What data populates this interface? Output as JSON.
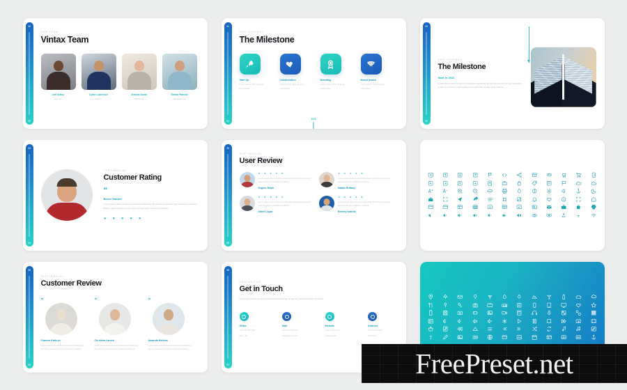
{
  "canvas": {
    "background": "#eceded",
    "accent_teal": "#1fb9c2",
    "accent_blue": "#1860bd"
  },
  "watermark": {
    "text": "FreePreset.net"
  },
  "slides": [
    {
      "id": "team",
      "page_top": "30",
      "page_bottom": "30",
      "eyebrow": "OUR TEAM",
      "title": "Vintax Team",
      "members": [
        {
          "name": "Carl Arthur",
          "role": "Founder"
        },
        {
          "name": "Dylan Lawrence",
          "role": "Expert"
        },
        {
          "name": "Jessica Sarah",
          "role": "Marketing"
        },
        {
          "name": "Emma Pamela",
          "role": "Management"
        }
      ]
    },
    {
      "id": "milestone-icons",
      "page_top": "31",
      "page_bottom": "31",
      "eyebrow": "OUR JOURNEY",
      "title": "The Milestone",
      "items": [
        {
          "icon": "rocket-icon",
          "label": "Start Up",
          "text": "Lorem ipsum dolor sit amet consectetur",
          "color": "teal"
        },
        {
          "icon": "handshake-icon",
          "label": "Collaboration",
          "text": "Lorem ipsum dolor sit amet consectetur",
          "color": "blue"
        },
        {
          "icon": "medal-icon",
          "label": "Branding",
          "text": "Lorem ipsum dolor sit amet consectetur",
          "color": "teal"
        },
        {
          "icon": "trophy-icon",
          "label": "Brand Award",
          "text": "Lorem ipsum dolor sit amet consectetur",
          "color": "blue"
        }
      ],
      "timeline_year": "2020"
    },
    {
      "id": "milestone-detail",
      "page_top": "32",
      "page_bottom": "32",
      "eyebrow": "OUR JOURNEY",
      "title": "The Milestone",
      "subtitle": "Start in 2022",
      "body": "Lorem ipsum dolor sit amet consectetur adipiscing elit sed do eiusmod tempor incididunt ut labore et dolore magna aliqua enim ad minim veniam quis nostrud.",
      "year_marker": "2022",
      "image_alt": "modern-building-photo"
    },
    {
      "id": "customer-rating",
      "page_top": "33",
      "page_bottom": "34",
      "eyebrow": "TESTIMONIAL",
      "title": "Customer Rating",
      "quote_mark": "“",
      "reviewer": "Bruce Gabriel",
      "text": "Lorem ipsum dolor sit amet consectetur adipiscing elit sed do eiusmod tempor incididunt ut labore dolore magna aliqua ut enim minim veniam quis nostrud exercitation.",
      "stars": 5
    },
    {
      "id": "user-review",
      "page_top": "35",
      "page_bottom": "35",
      "eyebrow": "TESTIMONIAL",
      "title": "User Review",
      "reviews": [
        {
          "name": "Eugene Ralph",
          "text": "Lorem ipsum dolor sit amet consectetur adipiscing elit sed do eiusmod tempor incididunt ut labore.",
          "stars": 5
        },
        {
          "name": "Natalie Brittany",
          "text": "Lorem ipsum dolor sit amet consectetur adipiscing elit sed do eiusmod tempor incididunt ut labore.",
          "stars": 5
        },
        {
          "name": "Albert Logan",
          "text": "Lorem ipsum dolor sit amet consectetur adipiscing elit sed do eiusmod tempor incididunt ut labore.",
          "stars": 5
        },
        {
          "name": "Beverly Isabella",
          "text": "Lorem ipsum dolor sit amet consectetur adipiscing elit sed do eiusmod tempor incididunt ut labore.",
          "stars": 5
        }
      ]
    },
    {
      "id": "icon-pack-light",
      "rows": 6,
      "columns": 12,
      "icon_color": "#2a9fb5",
      "icon_names": [
        "login-icon",
        "upload-box-icon",
        "download-box-icon",
        "new-window-icon",
        "flag-box-icon",
        "code-icon",
        "share-icon",
        "archive-icon",
        "mask-icon",
        "cart-icon",
        "shopping-cart-icon",
        "door-icon",
        "arrow-left-box-icon",
        "arrow-right-box-icon",
        "arrow-up-box-icon",
        "arrow-down-box-icon",
        "upload-icon",
        "briefcase-icon",
        "bag-icon",
        "tag-icon",
        "book-icon",
        "flag-icon",
        "cloud-icon",
        "cloud-upload-icon",
        "font-increase-icon",
        "font-decrease-icon",
        "zoom-in-icon",
        "zoom-out-icon",
        "cloud-outline-icon",
        "printer-icon",
        "droplet-icon",
        "shape-icon",
        "sun-icon",
        "megaphone-icon",
        "anchor-icon",
        "moon-icon",
        "toolbox-icon",
        "expand-icon",
        "send-icon",
        "clip-icon",
        "menu-icon",
        "frame-icon",
        "crop-icon",
        "bell-icon",
        "heart-icon",
        "clock-icon",
        "fullscreen-icon",
        "home-icon",
        "window-icon",
        "browser-icon",
        "layout-icon",
        "table-icon",
        "add-box-icon",
        "window-frame-icon",
        "check-box-icon",
        "panel-icon",
        "mail-solid-icon",
        "case-solid-icon",
        "bag-solid-icon",
        "printer-solid-icon",
        "volume-mute-icon",
        "volume-low-icon",
        "volume-mid-icon",
        "volume-high-icon",
        "volume-icon",
        "volume-plus-icon",
        "volume-max-icon",
        "eye-icon",
        "eye-open-icon",
        "link-icon",
        "wifi-low-icon",
        "wifi-icon"
      ]
    },
    {
      "id": "customer-review",
      "page_top": "36",
      "page_bottom": "35",
      "eyebrow": "TESTIMONIAL",
      "title": "Customer Review",
      "reviews": [
        {
          "name": "Frances Kathryn",
          "text": "Lorem ipsum dolor sit amet consectetur adipiscing elit sed do eiusmod tempor incididunt ut labore.",
          "quote": "“"
        },
        {
          "name": "Christina Lauren",
          "text": "Lorem ipsum dolor sit amet consectetur adipiscing elit sed do eiusmod tempor incididunt ut labore.",
          "quote": "“"
        },
        {
          "name": "Amanda Melissa",
          "text": "Lorem ipsum dolor sit amet consectetur adipiscing elit sed do eiusmod tempor incididunt ut labore.",
          "quote": "“"
        }
      ]
    },
    {
      "id": "get-in-touch",
      "page_top": "36",
      "page_bottom": "37",
      "eyebrow": "CONTACT US",
      "title": "Get in Touch",
      "lede": "Lorem ipsum dolor sit amet consectetur adipiscing elit sed do eiusmod tempor incididunt.",
      "contacts": [
        {
          "label": "Office",
          "text": "+00 123 456 789",
          "text2": "Mon - Fri",
          "color": "teal"
        },
        {
          "label": "Mail",
          "text": "hello@vintax.com",
          "text2": "info@vintax.com",
          "color": "blue"
        },
        {
          "label": "Website",
          "text": "www.vintax.com",
          "text2": "vintax.studio",
          "color": "teal"
        },
        {
          "label": "Address",
          "text": "4140 Parker Rd.",
          "text2": "Allentown",
          "color": "blue"
        }
      ]
    },
    {
      "id": "icon-pack-gradient",
      "rows": 6,
      "columns": 12,
      "icon_color": "#ffffff",
      "background_gradient": [
        "#16c7c0",
        "#1577c6"
      ],
      "icon_names": [
        "pin-icon",
        "tree-icon",
        "envelope-icon",
        "balloon-icon",
        "plant-icon",
        "drop-icon",
        "fire-icon",
        "mountain-icon",
        "cocktail-icon",
        "bottle-icon",
        "cloud-icon",
        "cloud-rain-icon",
        "cutlery-icon",
        "spoon-icon",
        "key-icon",
        "camera-icon",
        "tv-icon",
        "radio-icon",
        "book-icon",
        "phone-icon",
        "tablet-icon",
        "monitor-icon",
        "heart-icon",
        "star-icon",
        "mobile-icon",
        "save-icon",
        "album-icon",
        "battery-icon",
        "photo-icon",
        "video-icon",
        "calculator-icon",
        "headphone-icon",
        "microphone-icon",
        "qr-icon",
        "dice-icon",
        "grid-icon",
        "id-card-icon",
        "volume-low-icon",
        "volume-mid-icon",
        "volume-high-icon",
        "volume-mute-icon",
        "snow-icon",
        "play-icon",
        "pause-icon",
        "stop-icon",
        "forward-icon",
        "expand-icon",
        "fullscreen-icon",
        "basket-icon",
        "music-file-icon",
        "rewind-icon",
        "triangle-icon",
        "list-icon",
        "prev-icon",
        "next-icon",
        "shuffle-icon",
        "repeat-icon",
        "note-icon",
        "notes-icon",
        "music-box-icon",
        "question-icon",
        "pen-icon",
        "image-icon",
        "ticket-icon",
        "globe-icon",
        "window-icon",
        "chart-icon",
        "calendar-icon",
        "layout-icon",
        "table-icon",
        "resize-icon",
        "anchor-icon"
      ]
    }
  ]
}
